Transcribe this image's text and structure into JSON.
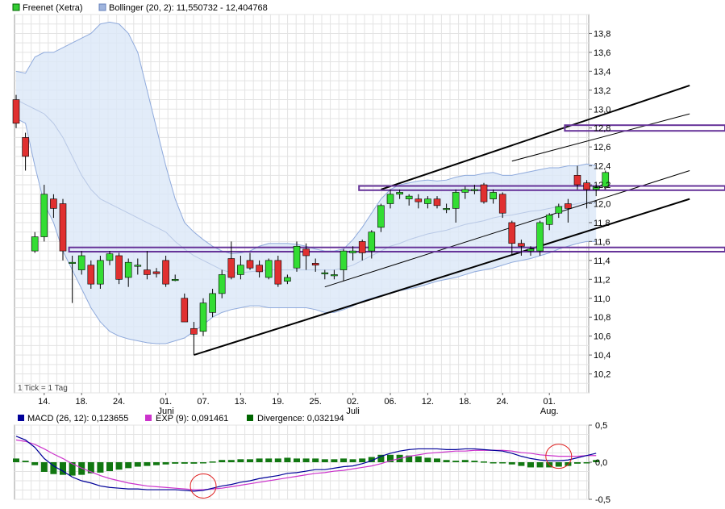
{
  "chart_data": [
    {
      "type": "candlestick",
      "legend": [
        {
          "label": "Freenet (Xetra)",
          "color": "#33cc33"
        },
        {
          "label": "Bollinger (20, 2): 11,550732 - 12,404768",
          "color": "#9fb4dd"
        }
      ],
      "tick_note": "1 Tick = 1 Tag",
      "ylim": [
        10.0,
        14.0
      ],
      "yticks": [
        "13,8",
        "13,6",
        "13,4",
        "13,2",
        "13,0",
        "12,8",
        "12,6",
        "12,4",
        "12,2",
        "12,0",
        "11,8",
        "11,6",
        "11,4",
        "11,2",
        "11,0",
        "10,8",
        "10,6",
        "10,4",
        "10,2"
      ],
      "ytick_values": [
        13.8,
        13.6,
        13.4,
        13.2,
        13.0,
        12.8,
        12.6,
        12.4,
        12.2,
        12.0,
        11.8,
        11.6,
        11.4,
        11.2,
        11.0,
        10.8,
        10.6,
        10.4,
        10.2
      ],
      "xticks": [
        {
          "label": "14.",
          "i": 3
        },
        {
          "label": "18.",
          "i": 7
        },
        {
          "label": "24.",
          "i": 11
        },
        {
          "label": "01.",
          "i": 16
        },
        {
          "label": "07.",
          "i": 20
        },
        {
          "label": "13.",
          "i": 24
        },
        {
          "label": "19.",
          "i": 28
        },
        {
          "label": "25.",
          "i": 32
        },
        {
          "label": "02.",
          "i": 36
        },
        {
          "label": "06.",
          "i": 40
        },
        {
          "label": "12.",
          "i": 44
        },
        {
          "label": "18.",
          "i": 48
        },
        {
          "label": "24.",
          "i": 52
        },
        {
          "label": "01.",
          "i": 57
        }
      ],
      "month_labels": [
        {
          "label": "Juni",
          "i": 16
        },
        {
          "label": "Juli",
          "i": 36
        },
        {
          "label": "Aug.",
          "i": 57
        }
      ],
      "candles": [
        {
          "o": 13.1,
          "h": 13.15,
          "l": 12.8,
          "c": 12.85
        },
        {
          "o": 12.7,
          "h": 12.75,
          "l": 12.35,
          "c": 12.5
        },
        {
          "o": 11.5,
          "h": 11.7,
          "l": 11.48,
          "c": 11.65
        },
        {
          "o": 11.65,
          "h": 12.2,
          "l": 11.6,
          "c": 12.1
        },
        {
          "o": 12.05,
          "h": 12.1,
          "l": 11.85,
          "c": 11.95
        },
        {
          "o": 12.0,
          "h": 12.05,
          "l": 11.4,
          "c": 11.5
        },
        {
          "o": 11.38,
          "h": 11.45,
          "l": 10.95,
          "c": 11.38
        },
        {
          "o": 11.3,
          "h": 11.5,
          "l": 11.25,
          "c": 11.45
        },
        {
          "o": 11.35,
          "h": 11.4,
          "l": 11.1,
          "c": 11.15
        },
        {
          "o": 11.15,
          "h": 11.45,
          "l": 11.1,
          "c": 11.4
        },
        {
          "o": 11.4,
          "h": 11.5,
          "l": 11.35,
          "c": 11.47
        },
        {
          "o": 11.45,
          "h": 11.48,
          "l": 11.15,
          "c": 11.2
        },
        {
          "o": 11.22,
          "h": 11.42,
          "l": 11.12,
          "c": 11.38
        },
        {
          "o": 11.35,
          "h": 11.42,
          "l": 11.25,
          "c": 11.35
        },
        {
          "o": 11.3,
          "h": 11.5,
          "l": 11.2,
          "c": 11.25
        },
        {
          "o": 11.28,
          "h": 11.32,
          "l": 11.22,
          "c": 11.26
        },
        {
          "o": 11.4,
          "h": 11.45,
          "l": 11.12,
          "c": 11.15
        },
        {
          "o": 11.2,
          "h": 11.25,
          "l": 11.18,
          "c": 11.2
        },
        {
          "o": 11.0,
          "h": 11.05,
          "l": 10.75,
          "c": 10.75
        },
        {
          "o": 10.68,
          "h": 10.75,
          "l": 10.4,
          "c": 10.62
        },
        {
          "o": 10.65,
          "h": 11.0,
          "l": 10.6,
          "c": 10.95
        },
        {
          "o": 10.85,
          "h": 11.1,
          "l": 10.8,
          "c": 11.05
        },
        {
          "o": 11.05,
          "h": 11.3,
          "l": 11.0,
          "c": 11.25
        },
        {
          "o": 11.42,
          "h": 11.6,
          "l": 11.2,
          "c": 11.22
        },
        {
          "o": 11.25,
          "h": 11.45,
          "l": 11.2,
          "c": 11.35
        },
        {
          "o": 11.4,
          "h": 11.48,
          "l": 11.3,
          "c": 11.32
        },
        {
          "o": 11.35,
          "h": 11.4,
          "l": 11.22,
          "c": 11.28
        },
        {
          "o": 11.22,
          "h": 11.42,
          "l": 11.2,
          "c": 11.4
        },
        {
          "o": 11.4,
          "h": 11.45,
          "l": 11.12,
          "c": 11.15
        },
        {
          "o": 11.18,
          "h": 11.25,
          "l": 11.15,
          "c": 11.22
        },
        {
          "o": 11.32,
          "h": 11.6,
          "l": 11.28,
          "c": 11.55
        },
        {
          "o": 11.52,
          "h": 11.58,
          "l": 11.3,
          "c": 11.45
        },
        {
          "o": 11.37,
          "h": 11.42,
          "l": 11.28,
          "c": 11.35
        },
        {
          "o": 11.26,
          "h": 11.3,
          "l": 11.2,
          "c": 11.27
        },
        {
          "o": 11.25,
          "h": 11.3,
          "l": 11.2,
          "c": 11.25
        },
        {
          "o": 11.3,
          "h": 11.52,
          "l": 11.18,
          "c": 11.5
        },
        {
          "o": 11.48,
          "h": 11.55,
          "l": 11.4,
          "c": 11.5
        },
        {
          "o": 11.6,
          "h": 11.62,
          "l": 11.4,
          "c": 11.48
        },
        {
          "o": 11.5,
          "h": 11.72,
          "l": 11.42,
          "c": 11.7
        },
        {
          "o": 11.75,
          "h": 12.0,
          "l": 11.7,
          "c": 11.98
        },
        {
          "o": 12.0,
          "h": 12.15,
          "l": 11.95,
          "c": 12.1
        },
        {
          "o": 12.1,
          "h": 12.15,
          "l": 12.05,
          "c": 12.12
        },
        {
          "o": 12.05,
          "h": 12.1,
          "l": 11.98,
          "c": 12.08
        },
        {
          "o": 12.05,
          "h": 12.1,
          "l": 11.95,
          "c": 12.02
        },
        {
          "o": 12.0,
          "h": 12.08,
          "l": 11.95,
          "c": 12.05
        },
        {
          "o": 12.05,
          "h": 12.08,
          "l": 11.95,
          "c": 11.98
        },
        {
          "o": 11.95,
          "h": 12.0,
          "l": 11.9,
          "c": 11.95
        },
        {
          "o": 11.95,
          "h": 12.15,
          "l": 11.8,
          "c": 12.12
        },
        {
          "o": 12.12,
          "h": 12.18,
          "l": 12.05,
          "c": 12.15
        },
        {
          "o": 12.15,
          "h": 12.2,
          "l": 12.1,
          "c": 12.15
        },
        {
          "o": 12.2,
          "h": 12.22,
          "l": 12.0,
          "c": 12.02
        },
        {
          "o": 12.05,
          "h": 12.15,
          "l": 12.0,
          "c": 12.12
        },
        {
          "o": 12.1,
          "h": 12.12,
          "l": 11.85,
          "c": 11.9
        },
        {
          "o": 11.8,
          "h": 11.82,
          "l": 11.45,
          "c": 11.58
        },
        {
          "o": 11.58,
          "h": 11.62,
          "l": 11.45,
          "c": 11.55
        },
        {
          "o": 11.5,
          "h": 11.55,
          "l": 11.45,
          "c": 11.52
        },
        {
          "o": 11.5,
          "h": 11.82,
          "l": 11.45,
          "c": 11.8
        },
        {
          "o": 11.78,
          "h": 11.9,
          "l": 11.72,
          "c": 11.88
        },
        {
          "o": 11.9,
          "h": 12.0,
          "l": 11.85,
          "c": 11.97
        },
        {
          "o": 12.0,
          "h": 12.05,
          "l": 11.8,
          "c": 11.95
        },
        {
          "o": 12.3,
          "h": 12.4,
          "l": 12.15,
          "c": 12.2
        },
        {
          "o": 12.22,
          "h": 12.25,
          "l": 11.95,
          "c": 12.15
        },
        {
          "o": 12.15,
          "h": 12.2,
          "l": 12.08,
          "c": 12.18
        },
        {
          "o": 12.18,
          "h": 12.35,
          "l": 12.15,
          "c": 12.33
        }
      ],
      "bollinger_upper": [
        13.4,
        13.38,
        13.55,
        13.6,
        13.6,
        13.65,
        13.7,
        13.75,
        13.8,
        13.9,
        13.92,
        13.9,
        13.8,
        13.6,
        13.2,
        12.8,
        12.4,
        12.05,
        11.8,
        11.7,
        11.62,
        11.55,
        11.5,
        11.47,
        11.48,
        11.5,
        11.55,
        11.58,
        11.58,
        11.58,
        11.57,
        11.55,
        11.52,
        11.5,
        11.5,
        11.52,
        11.62,
        11.75,
        11.9,
        12.05,
        12.15,
        12.2,
        12.22,
        12.24,
        12.25,
        12.24,
        12.25,
        12.28,
        12.3,
        12.3,
        12.32,
        12.33,
        12.3,
        12.3,
        12.32,
        12.34,
        12.36,
        12.38,
        12.38,
        12.4,
        12.4,
        12.42,
        12.4
      ],
      "bollinger_mid": [
        13.1,
        13.05,
        13.0,
        12.95,
        12.85,
        12.7,
        12.5,
        12.3,
        12.15,
        12.05,
        12.0,
        11.95,
        11.9,
        11.85,
        11.8,
        11.75,
        11.7,
        11.6,
        11.52,
        11.45,
        11.4,
        11.35,
        11.3,
        11.27,
        11.27,
        11.28,
        11.29,
        11.3,
        11.3,
        11.3,
        11.3,
        11.3,
        11.3,
        11.3,
        11.3,
        11.32,
        11.35,
        11.4,
        11.45,
        11.5,
        11.55,
        11.58,
        11.62,
        11.65,
        11.68,
        11.7,
        11.72,
        11.75,
        11.78,
        11.8,
        11.82,
        11.85,
        11.87,
        11.88,
        11.9,
        11.92,
        11.93,
        11.95,
        11.97,
        11.98,
        12.0,
        12.02,
        12.0
      ],
      "bollinger_lower": [
        12.9,
        12.85,
        12.4,
        12.0,
        11.8,
        11.5,
        11.3,
        11.1,
        10.9,
        10.75,
        10.65,
        10.6,
        10.57,
        10.55,
        10.53,
        10.52,
        10.52,
        10.55,
        10.58,
        10.65,
        10.72,
        10.8,
        10.85,
        10.88,
        10.9,
        10.92,
        10.92,
        10.9,
        10.9,
        10.9,
        10.9,
        10.9,
        10.88,
        10.85,
        10.85,
        10.88,
        10.92,
        10.97,
        11.0,
        11.03,
        11.05,
        11.08,
        11.1,
        11.12,
        11.15,
        11.18,
        11.2,
        11.22,
        11.25,
        11.28,
        11.3,
        11.32,
        11.35,
        11.38,
        11.4,
        11.42,
        11.45,
        11.48,
        11.52,
        11.55,
        11.58,
        11.6,
        11.6
      ],
      "trend_lines": [
        {
          "from": [
            19,
            10.4
          ],
          "to": [
            72,
            12.05
          ],
          "weight": "heavy"
        },
        {
          "from": [
            39,
            12.15
          ],
          "to": [
            72,
            13.25
          ],
          "weight": "heavy"
        },
        {
          "from": [
            33,
            11.12
          ],
          "to": [
            72,
            12.35
          ],
          "weight": "thin"
        },
        {
          "from": [
            53,
            12.45
          ],
          "to": [
            72,
            12.95
          ],
          "weight": "thin"
        }
      ],
      "horizontal_zones": [
        {
          "from_i": 6,
          "y": 11.515,
          "height": 0.045
        },
        {
          "from_i": 37,
          "y": 12.165,
          "height": 0.045
        },
        {
          "from_i": 59,
          "y": 12.8,
          "height": 0.06
        }
      ]
    },
    {
      "type": "bar+line",
      "legend": [
        {
          "label": "MACD (26, 12): 0,123655",
          "color": "#000099"
        },
        {
          "label": "EXP (9): 0,091461",
          "color": "#cc33cc"
        },
        {
          "label": "Divergence: 0,032194",
          "color": "#006600"
        }
      ],
      "ylim": [
        -0.5,
        0.5
      ],
      "yticks": [
        "0,5",
        "0,0",
        "-0,5"
      ],
      "ytick_values": [
        0.5,
        0.0,
        -0.5
      ],
      "macd": [
        0.35,
        0.3,
        0.2,
        0.05,
        -0.05,
        -0.12,
        -0.2,
        -0.25,
        -0.28,
        -0.32,
        -0.34,
        -0.35,
        -0.36,
        -0.36,
        -0.37,
        -0.37,
        -0.37,
        -0.37,
        -0.38,
        -0.39,
        -0.38,
        -0.35,
        -0.32,
        -0.3,
        -0.27,
        -0.25,
        -0.22,
        -0.2,
        -0.18,
        -0.15,
        -0.14,
        -0.12,
        -0.1,
        -0.1,
        -0.08,
        -0.06,
        -0.05,
        -0.02,
        0.02,
        0.08,
        0.12,
        0.15,
        0.17,
        0.18,
        0.18,
        0.18,
        0.17,
        0.17,
        0.18,
        0.18,
        0.17,
        0.16,
        0.15,
        0.12,
        0.08,
        0.05,
        0.03,
        0.02,
        0.02,
        0.03,
        0.06,
        0.09,
        0.12
      ],
      "signal": [
        0.3,
        0.28,
        0.24,
        0.18,
        0.11,
        0.05,
        -0.02,
        -0.08,
        -0.13,
        -0.18,
        -0.22,
        -0.25,
        -0.28,
        -0.3,
        -0.32,
        -0.33,
        -0.34,
        -0.35,
        -0.36,
        -0.37,
        -0.37,
        -0.36,
        -0.35,
        -0.33,
        -0.31,
        -0.29,
        -0.27,
        -0.25,
        -0.23,
        -0.21,
        -0.19,
        -0.17,
        -0.15,
        -0.14,
        -0.12,
        -0.11,
        -0.09,
        -0.07,
        -0.05,
        -0.02,
        0.02,
        0.05,
        0.08,
        0.1,
        0.12,
        0.13,
        0.14,
        0.15,
        0.15,
        0.16,
        0.16,
        0.16,
        0.16,
        0.15,
        0.13,
        0.12,
        0.1,
        0.09,
        0.08,
        0.08,
        0.08,
        0.09,
        0.09
      ],
      "divergence": [
        0.05,
        0.02,
        -0.04,
        -0.13,
        -0.16,
        -0.17,
        -0.18,
        -0.17,
        -0.15,
        -0.14,
        -0.12,
        -0.1,
        -0.08,
        -0.06,
        -0.05,
        -0.04,
        -0.03,
        -0.02,
        -0.02,
        -0.02,
        -0.01,
        0.01,
        0.03,
        0.03,
        0.04,
        0.04,
        0.05,
        0.05,
        0.05,
        0.06,
        0.05,
        0.05,
        0.05,
        0.04,
        0.04,
        0.05,
        0.04,
        0.05,
        0.07,
        0.1,
        0.1,
        0.1,
        0.09,
        0.08,
        0.06,
        0.05,
        0.03,
        0.02,
        0.03,
        0.02,
        0.01,
        0.0,
        -0.01,
        -0.03,
        -0.05,
        -0.07,
        -0.07,
        -0.07,
        -0.06,
        -0.05,
        -0.02,
        0.0,
        0.03
      ],
      "annotations": [
        {
          "i": 20,
          "y": -0.32
        },
        {
          "i": 58,
          "y": 0.08
        }
      ]
    }
  ]
}
